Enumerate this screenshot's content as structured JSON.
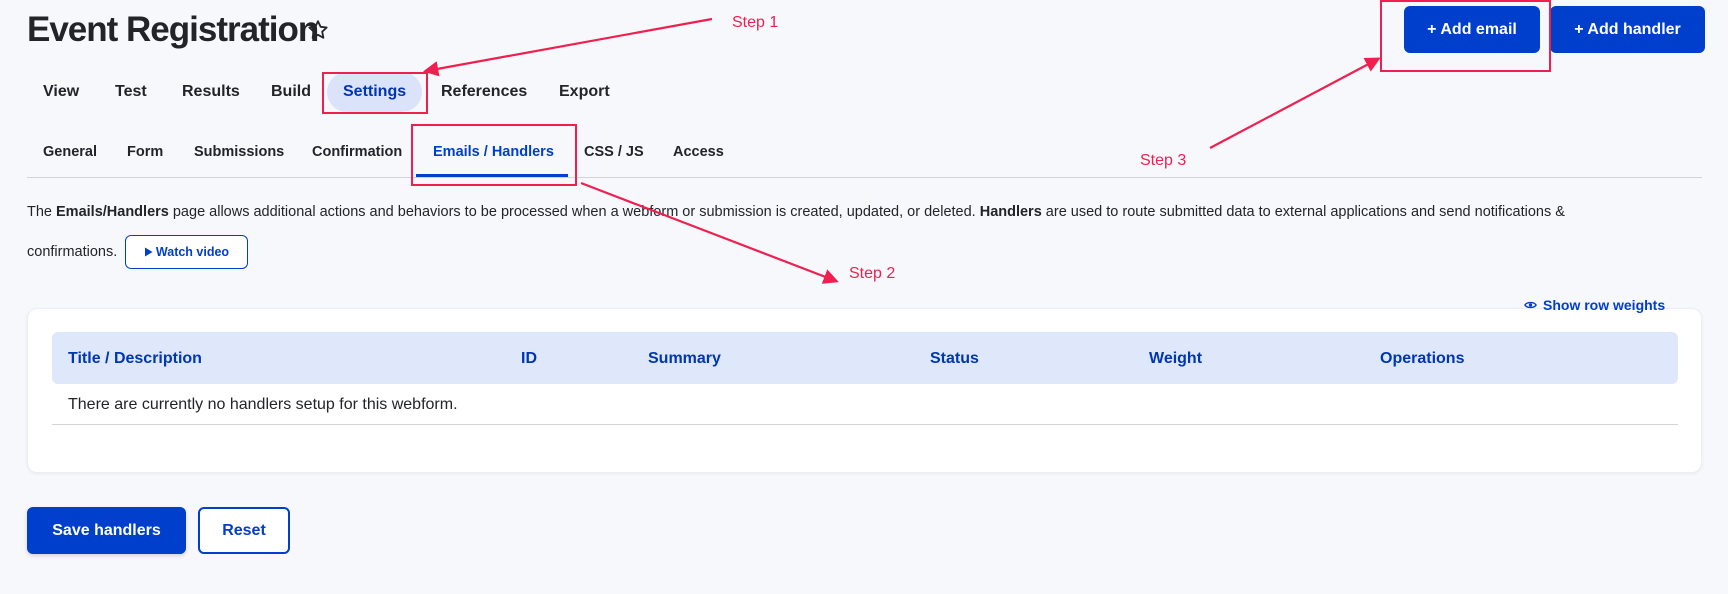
{
  "page": {
    "title": "Event Registration",
    "favorite_icon": "star-outline-icon"
  },
  "actions": {
    "add_email_label": "+ Add email",
    "add_handler_label": "+ Add handler"
  },
  "primary_tabs": [
    {
      "label": "View",
      "active": false
    },
    {
      "label": "Test",
      "active": false
    },
    {
      "label": "Results",
      "active": false
    },
    {
      "label": "Build",
      "active": false
    },
    {
      "label": "Settings",
      "active": true
    },
    {
      "label": "References",
      "active": false
    },
    {
      "label": "Export",
      "active": false
    }
  ],
  "secondary_tabs": [
    {
      "label": "General",
      "active": false
    },
    {
      "label": "Form",
      "active": false
    },
    {
      "label": "Submissions",
      "active": false
    },
    {
      "label": "Confirmation",
      "active": false
    },
    {
      "label": "Emails / Handlers",
      "active": true
    },
    {
      "label": "CSS / JS",
      "active": false
    },
    {
      "label": "Access",
      "active": false
    }
  ],
  "description": {
    "prefix": "The ",
    "bold1": "Emails/Handlers",
    "middle": " page allows additional actions and behaviors to be processed when a webform or submission is created, updated, or deleted. ",
    "bold2": "Handlers",
    "suffix": " are used to route submitted data to external applications and send notifications &",
    "line2": "confirmations.",
    "watch_video_label": "Watch video",
    "watch_video_icon": "play-triangle-icon"
  },
  "table": {
    "show_row_weights_label": "Show row weights",
    "show_row_weights_icon": "eye-icon",
    "columns": [
      "Title / Description",
      "ID",
      "Summary",
      "Status",
      "Weight",
      "Operations"
    ],
    "empty_message": "There are currently no handlers setup for this webform."
  },
  "form_actions": {
    "save_label": "Save handlers",
    "reset_label": "Reset"
  },
  "annotations": {
    "step1": "Step 1",
    "step2": "Step 2",
    "step3": "Step 3",
    "color": "#ef1f4f"
  },
  "colors": {
    "accent": "#003ecc",
    "active_tab_bg": "#dbe3fb",
    "table_header_bg": "#dfe7fa",
    "page_bg": "#f7f8fc"
  }
}
